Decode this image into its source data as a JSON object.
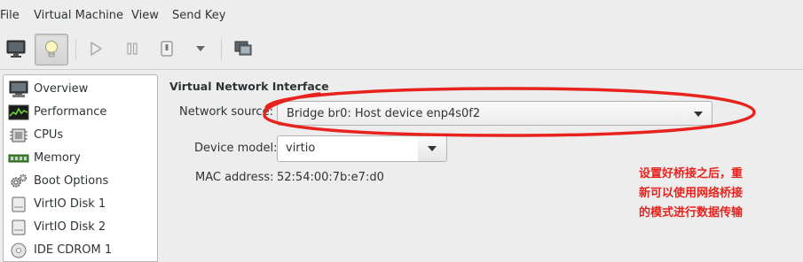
{
  "menubar": {
    "file": "File",
    "virtual_machine": "Virtual Machine",
    "view": "View",
    "send_key": "Send Key"
  },
  "toolbar": {
    "buttons": [
      {
        "icon": "monitor-icon"
      },
      {
        "icon": "lightbulb-icon",
        "active": true
      },
      {
        "icon": "run-icon"
      },
      {
        "icon": "pause-icon"
      },
      {
        "icon": "shutdown-icon"
      },
      {
        "icon": "dropdown-arrow-icon"
      },
      {
        "icon": "fullscreen-icon"
      }
    ]
  },
  "sidebar": {
    "items": [
      {
        "label": "Overview",
        "icon": "monitor-icon"
      },
      {
        "label": "Performance",
        "icon": "performance-icon"
      },
      {
        "label": "CPUs",
        "icon": "cpu-icon"
      },
      {
        "label": "Memory",
        "icon": "memory-icon"
      },
      {
        "label": "Boot Options",
        "icon": "gears-icon"
      },
      {
        "label": "VirtIO Disk 1",
        "icon": "disk-icon"
      },
      {
        "label": "VirtIO Disk 2",
        "icon": "disk-icon"
      },
      {
        "label": "IDE CDROM 1",
        "icon": "cdrom-icon"
      }
    ]
  },
  "main": {
    "section_title": "Virtual Network Interface",
    "network_source_label": "Network source:",
    "network_source_value": "Bridge br0: Host device enp4s0f2",
    "device_model_label": "Device model:",
    "device_model_value": "virtio",
    "mac_label": "MAC address:",
    "mac_value": "52:54:00:7b:e7:d0"
  },
  "annotation": {
    "color": "#e8231d",
    "lines": [
      "设置好桥接之后，重",
      "新可以使用网络桥接",
      "的模式进行数据传输"
    ]
  }
}
